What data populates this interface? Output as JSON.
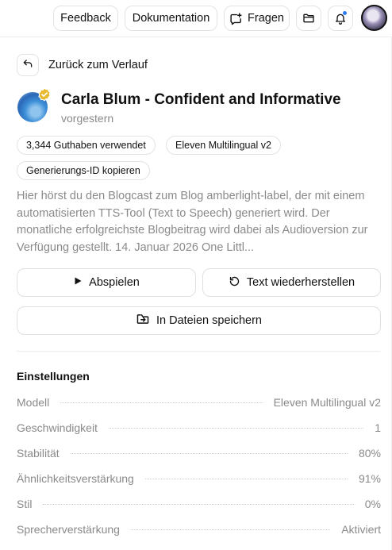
{
  "topbar": {
    "feedback": "Feedback",
    "docs": "Dokumentation",
    "ask": "Fragen"
  },
  "back": {
    "label": "Zurück zum Verlauf"
  },
  "voice": {
    "title": "Carla Blum - Confident and Informative",
    "time": "vorgestern"
  },
  "chips": {
    "credits": "3,344 Guthaben verwendet",
    "model": "Eleven Multilingual v2",
    "copy_id": "Generierungs-ID kopieren"
  },
  "description": "Hier hörst du den Blogcast zum Blog amberlight-label, der mit einem automatisierten TTS-Tool (Text to Speech) generiert wird. Der monatliche erfolgreichste Blogbeitrag wird dabei als Audioversion zur Verfügung gestellt. 14. Januar 2026 One Littl...",
  "actions": {
    "play": "Abspielen",
    "restore": "Text wiederherstellen",
    "save": "In Dateien speichern"
  },
  "settings": {
    "title": "Einstellungen",
    "rows": [
      {
        "label": "Modell",
        "value": "Eleven Multilingual v2"
      },
      {
        "label": "Geschwindigkeit",
        "value": "1"
      },
      {
        "label": "Stabilität",
        "value": "80%"
      },
      {
        "label": "Ähnlichkeitsverstärkung",
        "value": "91%"
      },
      {
        "label": "Stil",
        "value": "0%"
      },
      {
        "label": "Sprecherverstärkung",
        "value": "Aktiviert"
      }
    ]
  },
  "colors": {
    "accent_dot": "#2f7bf6",
    "verified_badge": "#e7b92f",
    "muted_text": "#8a8a8a"
  },
  "icons": [
    "chat-plus-icon",
    "folder-icon",
    "bell-icon",
    "back-arrow-icon",
    "verified-badge-icon",
    "play-icon",
    "restore-icon",
    "save-to-files-icon"
  ]
}
